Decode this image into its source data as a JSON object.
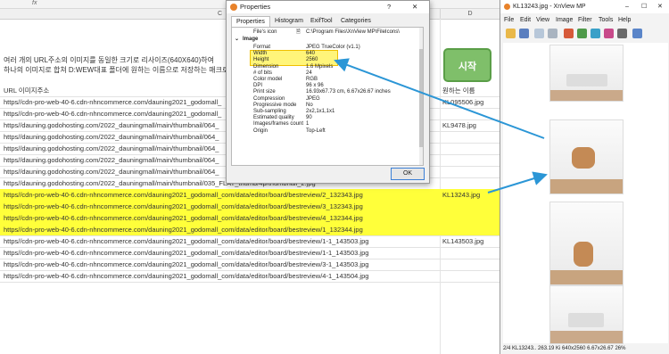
{
  "spreadsheet": {
    "formula_bar_symbol": "fx",
    "columns": [
      "C",
      "D"
    ],
    "description_line1": "여러 개의 URL주소의 이미지를 동일한 크기로 리사이즈(640X640)하여",
    "description_line2": "하나의 이미지로 합쳐 D:WEW대표 폴더에 원하는 이름으로 저장하는 매크로",
    "start_button": "시작",
    "header_a": "URL 이미지주소",
    "header_d": "원하는 이름",
    "rows": [
      {
        "a": "https//cdn-pro-web-40-6.cdn-nhncommerce.com/dauning2021_godomall_",
        "d": "KL095506.jpg",
        "hl": false
      },
      {
        "a": "https//cdn-pro-web-40-6.cdn-nhncommerce.com/dauning2021_godomall_",
        "d": "",
        "hl": false
      },
      {
        "a": "https//dauning.godohosting.com/2022_dauningmall/main/thumbnail/064_",
        "d": "KL9478.jpg",
        "hl": false
      },
      {
        "a": "https//dauning.godohosting.com/2022_dauningmall/main/thumbnail/064_",
        "d": "",
        "hl": false
      },
      {
        "a": "https//dauning.godohosting.com/2022_dauningmall/main/thumbnail/064_",
        "d": "",
        "hl": false
      },
      {
        "a": "https//dauning.godohosting.com/2022_dauningmall/main/thumbnail/064_",
        "d": "",
        "hl": false
      },
      {
        "a": "https//dauning.godohosting.com/2022_dauningmall/main/thumbnail/064_",
        "d": "",
        "hl": false
      },
      {
        "a": "https//dauning.godohosting.com/2022_dauningmall/main/thumbnail/035_FLAT_thumb/4p/thumbnail_2.jpg",
        "d": "",
        "hl": false
      },
      {
        "a": "https//cdn-pro-web-40-6.cdn-nhncommerce.com/dauning2021_godomall_com/data/editor/board/bestreview/2_132343.jpg",
        "d": "KL13243.jpg",
        "hl": true
      },
      {
        "a": "https//cdn-pro-web-40-6.cdn-nhncommerce.com/dauning2021_godomall_com/data/editor/board/bestreview/3_132343.jpg",
        "d": "",
        "hl": true
      },
      {
        "a": "https//cdn-pro-web-40-6.cdn-nhncommerce.com/dauning2021_godomall_com/data/editor/board/bestreview/4_132344.jpg",
        "d": "",
        "hl": true
      },
      {
        "a": "https//cdn-pro-web-40-6.cdn-nhncommerce.com/dauning2021_godomall_com/data/editor/board/bestreview/1_132344.jpg",
        "d": "",
        "hl": true
      },
      {
        "a": "https//cdn-pro-web-40-6.cdn-nhncommerce.com/dauning2021_godomall_com/data/editor/board/bestreview/1-1_143503.jpg",
        "d": "KL143503.jpg",
        "hl": false
      },
      {
        "a": "https//cdn-pro-web-40-6.cdn-nhncommerce.com/dauning2021_godomall_com/data/editor/board/bestreview/1-1_143503.jpg",
        "d": "",
        "hl": false
      },
      {
        "a": "https//cdn-pro-web-40-6.cdn-nhncommerce.com/dauning2021_godomall_com/data/editor/board/bestreview/3-1_143503.jpg",
        "d": "",
        "hl": false
      },
      {
        "a": "https//cdn-pro-web-40-6.cdn-nhncommerce.com/dauning2021_godomall_com/data/editor/board/bestreview/4-1_143504.jpg",
        "d": "",
        "hl": false
      }
    ]
  },
  "properties": {
    "title": "Properties",
    "help": "?",
    "close": "✕",
    "tabs": [
      "Properties",
      "Histogram",
      "ExifTool",
      "Categories"
    ],
    "file_icon_label": "File's icon",
    "file_icon_value": "C:\\Program Files\\XnView MP\\FileIcons\\",
    "section": "Image",
    "rows": [
      {
        "k": "Format",
        "v": "JPEG TrueColor (v1.1)"
      },
      {
        "k": "Width",
        "v": "640"
      },
      {
        "k": "Height",
        "v": "2560"
      },
      {
        "k": "Dimension",
        "v": "1.6 Mpixels"
      },
      {
        "k": "# of bits",
        "v": "24"
      },
      {
        "k": "Color model",
        "v": "RGB"
      },
      {
        "k": "DPI",
        "v": "96 x 96"
      },
      {
        "k": "Print size",
        "v": "16.93x67.73 cm, 6.67x26.67 inches"
      },
      {
        "k": "Compression",
        "v": "JPEG"
      },
      {
        "k": "Progressive mode",
        "v": "No"
      },
      {
        "k": "Sub-sampling",
        "v": "2x2,1x1,1x1"
      },
      {
        "k": "Estimated quality",
        "v": "90"
      },
      {
        "k": "Images/frames count",
        "v": "1"
      },
      {
        "k": "Origin",
        "v": "Top-Left"
      }
    ],
    "ok": "OK"
  },
  "xnview": {
    "title": "KL13243.jpg - XnView MP",
    "menu": [
      "File",
      "Edit",
      "View",
      "Image",
      "Filter",
      "Tools",
      "Help"
    ],
    "status": "2/4  KL13243.. 263.19 Ki  640x2560  6.67x26.67  26%"
  },
  "colors": {
    "highlight": "#ffff3a",
    "start_button": "#7fbf6a",
    "arrow": "#2b96d6"
  }
}
